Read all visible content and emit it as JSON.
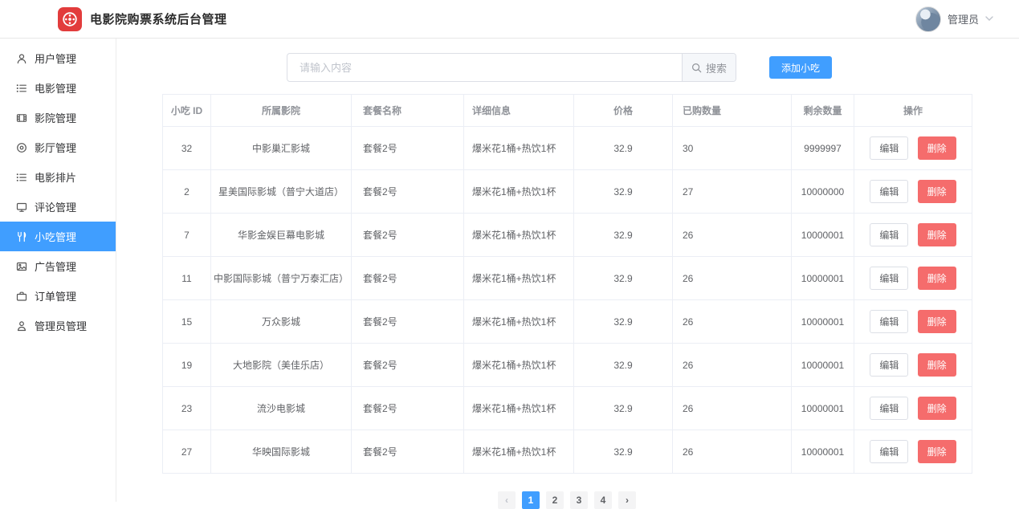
{
  "header": {
    "title": "电影院购票系统后台管理",
    "user_name": "管理员"
  },
  "sidebar": {
    "items": [
      {
        "label": "用户管理",
        "icon": "user-icon",
        "active": false
      },
      {
        "label": "电影管理",
        "icon": "list-icon",
        "active": false
      },
      {
        "label": "影院管理",
        "icon": "film-icon",
        "active": false
      },
      {
        "label": "影厅管理",
        "icon": "disc-icon",
        "active": false
      },
      {
        "label": "电影排片",
        "icon": "schedule-icon",
        "active": false
      },
      {
        "label": "评论管理",
        "icon": "monitor-icon",
        "active": false
      },
      {
        "label": "小吃管理",
        "icon": "snack-icon",
        "active": true
      },
      {
        "label": "广告管理",
        "icon": "picture-icon",
        "active": false
      },
      {
        "label": "订单管理",
        "icon": "briefcase-icon",
        "active": false
      },
      {
        "label": "管理员管理",
        "icon": "admin-icon",
        "active": false
      }
    ]
  },
  "toolbar": {
    "search_value": "",
    "search_placeholder": "请输入内容",
    "search_button_label": "搜索",
    "add_button_label": "添加小吃"
  },
  "table": {
    "columns": [
      "小吃 ID",
      "所属影院",
      "套餐名称",
      "详细信息",
      "价格",
      "已购数量",
      "剩余数量",
      "操作"
    ],
    "edit_label": "编辑",
    "delete_label": "删除",
    "rows": [
      {
        "id": "32",
        "cinema": "中影巢汇影城",
        "package": "套餐2号",
        "details": "爆米花1桶+热饮1杯",
        "price": "32.9",
        "purchased": "30",
        "remaining": "9999997"
      },
      {
        "id": "2",
        "cinema": "星美国际影城（普宁大道店）",
        "package": "套餐2号",
        "details": "爆米花1桶+热饮1杯",
        "price": "32.9",
        "purchased": "27",
        "remaining": "10000000"
      },
      {
        "id": "7",
        "cinema": "华影金娱巨幕电影城",
        "package": "套餐2号",
        "details": "爆米花1桶+热饮1杯",
        "price": "32.9",
        "purchased": "26",
        "remaining": "10000001"
      },
      {
        "id": "11",
        "cinema": "中影国际影城（普宁万泰汇店）",
        "package": "套餐2号",
        "details": "爆米花1桶+热饮1杯",
        "price": "32.9",
        "purchased": "26",
        "remaining": "10000001"
      },
      {
        "id": "15",
        "cinema": "万众影城",
        "package": "套餐2号",
        "details": "爆米花1桶+热饮1杯",
        "price": "32.9",
        "purchased": "26",
        "remaining": "10000001"
      },
      {
        "id": "19",
        "cinema": "大地影院（美佳乐店）",
        "package": "套餐2号",
        "details": "爆米花1桶+热饮1杯",
        "price": "32.9",
        "purchased": "26",
        "remaining": "10000001"
      },
      {
        "id": "23",
        "cinema": "流沙电影城",
        "package": "套餐2号",
        "details": "爆米花1桶+热饮1杯",
        "price": "32.9",
        "purchased": "26",
        "remaining": "10000001"
      },
      {
        "id": "27",
        "cinema": "华映国际影城",
        "package": "套餐2号",
        "details": "爆米花1桶+热饮1杯",
        "price": "32.9",
        "purchased": "26",
        "remaining": "10000001"
      }
    ]
  },
  "pagination": {
    "prev_icon": "‹",
    "next_icon": "›",
    "pages": [
      "1",
      "2",
      "3",
      "4"
    ],
    "active_page": "1"
  },
  "colors": {
    "accent": "#409EFF",
    "danger": "#F56C6C",
    "brand_red": "#E23C3C"
  }
}
